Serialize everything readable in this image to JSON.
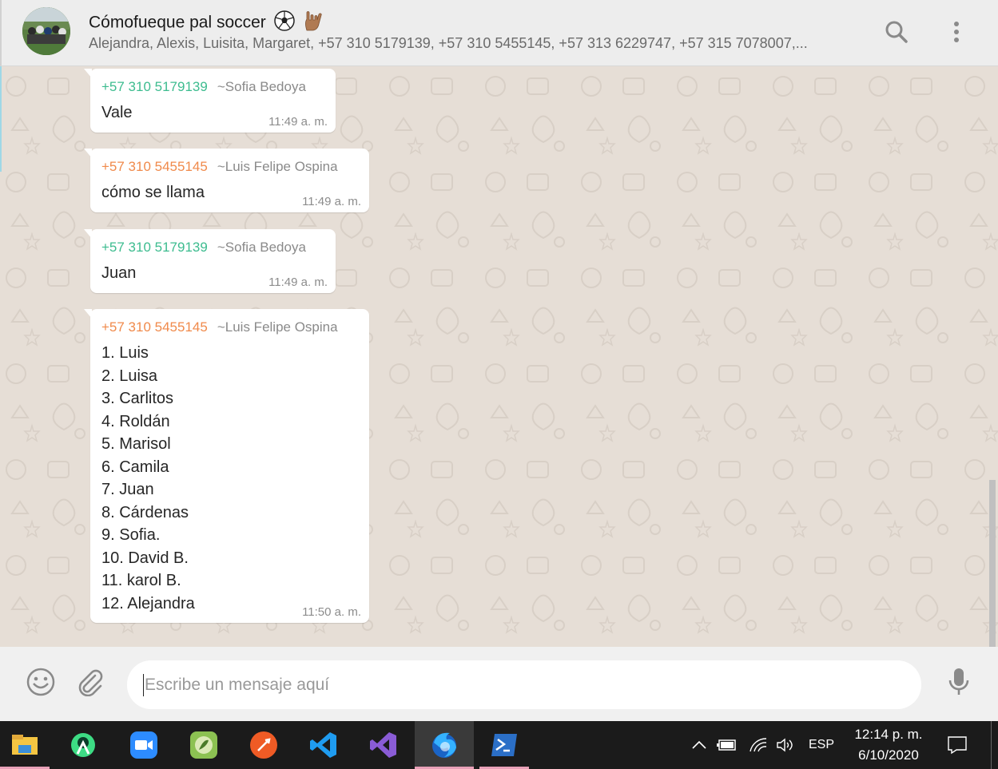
{
  "header": {
    "title": "Cómofueque pal soccer",
    "participants": "Alejandra, Alexis, Luisita, Margaret, +57 310 5179139, +57 310 5455145, +57 313 6229747, +57 315 7078007,..."
  },
  "messages": [
    {
      "phone": "+57 310 5179139",
      "alias": "~Sofia Bedoya",
      "text": "Vale",
      "time": "11:49 a. m.",
      "color": "#3dbc8f"
    },
    {
      "phone": "+57 310 5455145",
      "alias": "~Luis Felipe Ospina",
      "text": "cómo se llama",
      "time": "11:49 a. m.",
      "color": "#f08a4b"
    },
    {
      "phone": "+57 310 5179139",
      "alias": "~Sofia Bedoya",
      "text": "Juan",
      "time": "11:49 a. m.",
      "color": "#3dbc8f"
    },
    {
      "phone": "+57 310 5455145",
      "alias": "~Luis Felipe Ospina",
      "lines": [
        "1. Luis",
        "2. Luisa",
        "3. Carlitos",
        "4. Roldán",
        "5. Marisol",
        "6. Camila",
        "7. Juan",
        "8. Cárdenas",
        "9. Sofia.",
        "10. David B.",
        "11. karol B.",
        "12. Alejandra"
      ],
      "time": "11:50 a. m.",
      "color": "#f08a4b"
    }
  ],
  "composer": {
    "placeholder": "Escribe un mensaje aquí"
  },
  "taskbar": {
    "language": "ESP",
    "time": "12:14 p. m.",
    "date": "6/10/2020"
  },
  "colors": {
    "header_bg": "#ededed",
    "chat_bg": "#e6ded6",
    "bubble_bg": "#ffffff",
    "sofia_color": "#3dbc8f",
    "luis_color": "#f08a4b",
    "taskbar_bg": "#1b1b1b"
  },
  "icons": {
    "header": [
      "search-icon",
      "menu-icon"
    ],
    "composer": [
      "emoji-icon",
      "attach-icon",
      "microphone-icon"
    ],
    "taskbar_apps": [
      "file-explorer-icon",
      "android-studio-icon",
      "zoom-icon",
      "app-icon",
      "postman-icon",
      "vscode-icon",
      "visual-studio-icon",
      "firefox-icon",
      "powershell-icon"
    ]
  }
}
